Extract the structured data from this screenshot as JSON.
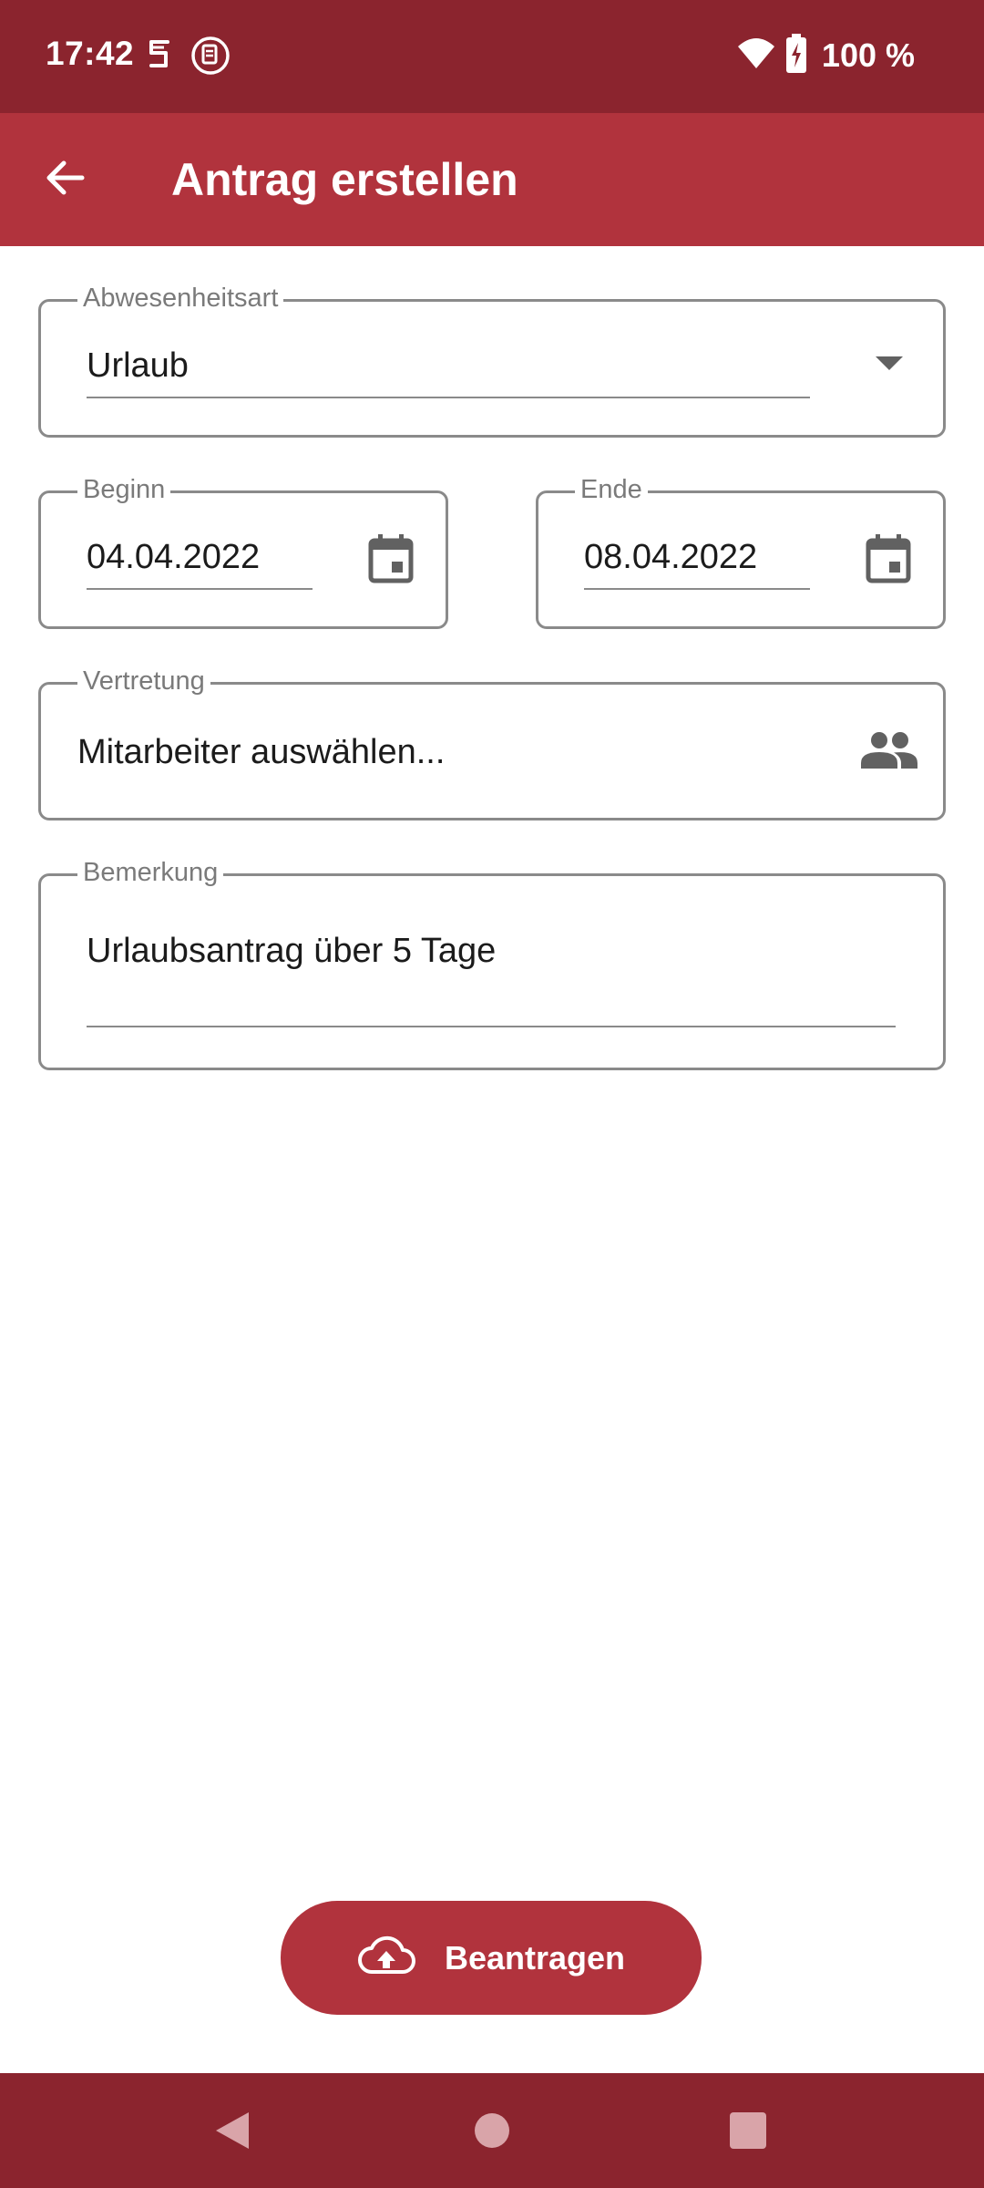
{
  "status_bar": {
    "time": "17:42",
    "battery_text": "100 %",
    "icons": [
      "s-icon",
      "app-notification-icon",
      "wifi-icon",
      "battery-charging-icon"
    ]
  },
  "app_bar": {
    "title": "Antrag erstellen",
    "back_icon": "arrow-left-icon"
  },
  "form": {
    "absence_type": {
      "label": "Abwesenheitsart",
      "value": "Urlaub"
    },
    "begin": {
      "label": "Beginn",
      "value": "04.04.2022"
    },
    "end": {
      "label": "Ende",
      "value": "08.04.2022"
    },
    "substitute": {
      "label": "Vertretung",
      "value": "Mitarbeiter auswählen..."
    },
    "remark": {
      "label": "Bemerkung",
      "value": "Urlaubsantrag über 5 Tage"
    }
  },
  "submit": {
    "label": "Beantragen",
    "icon": "cloud-upload-icon"
  },
  "colors": {
    "status_bar": "#8b242e",
    "app_bar": "#b1333d",
    "accent": "#b1333d",
    "field_border": "#8a8a8a",
    "label_text": "#7a7a7a",
    "icon_grey": "#616161"
  },
  "nav_bar": {
    "icons": [
      "back-triangle-icon",
      "home-circle-icon",
      "recents-square-icon"
    ]
  }
}
